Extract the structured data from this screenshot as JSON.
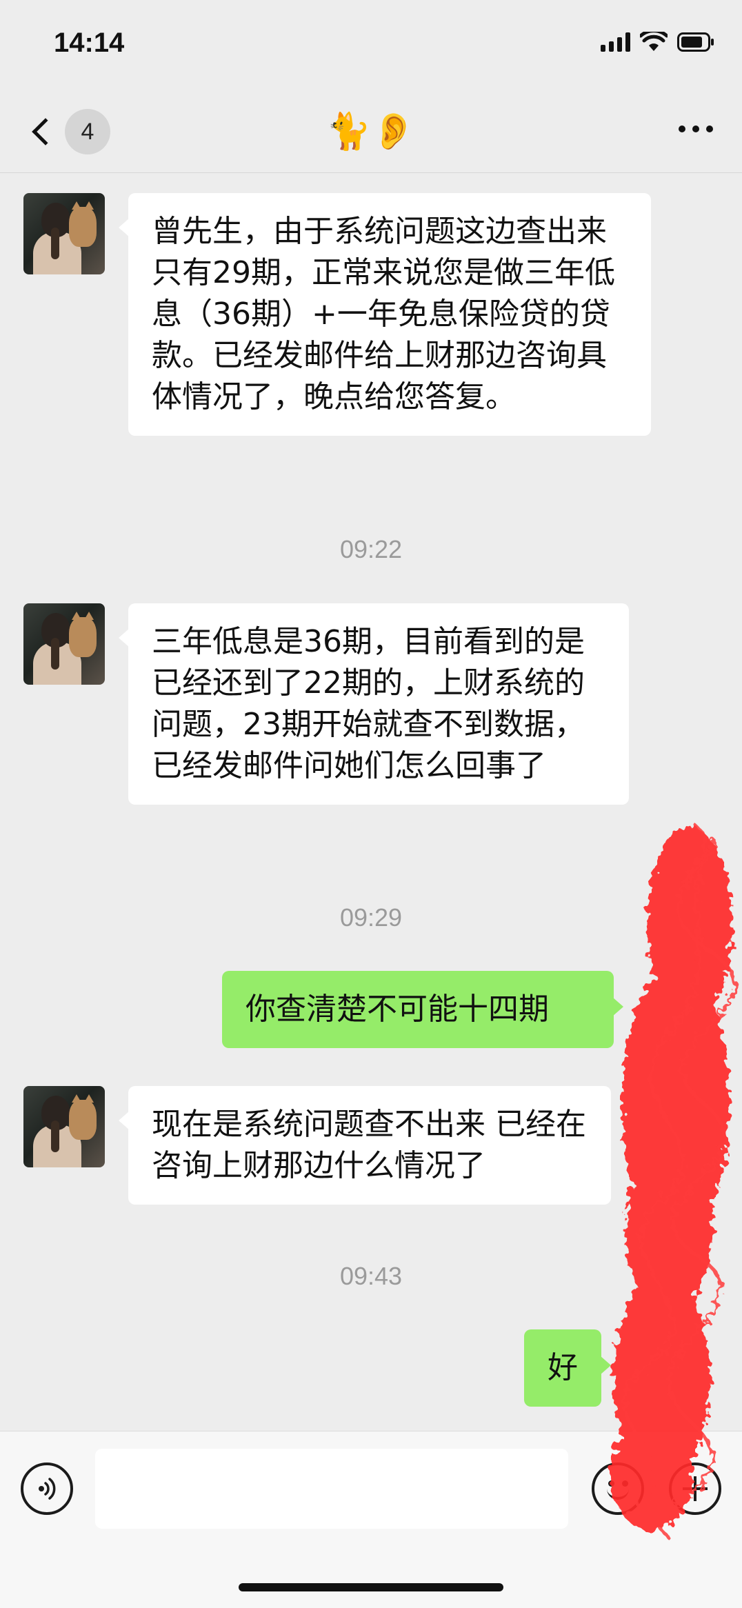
{
  "status_bar": {
    "time": "14:14"
  },
  "nav": {
    "unread_count": "4",
    "title": "🐈👂"
  },
  "messages": [
    {
      "side": "left",
      "text": " 曾先生，由于系统问题这边查出来只有29期，正常来说您是做三年低息（36期）+一年免息保险贷的贷款。已经发邮件给上财那边咨询具体情况了，晚点给您答复。"
    },
    {
      "type": "time",
      "text": "09:22"
    },
    {
      "side": "left",
      "text": "三年低息是36期，目前看到的是已经还到了22期的，上财系统的问题，23期开始就查不到数据，已经发邮件问她们怎么回事了"
    },
    {
      "type": "time",
      "text": "09:29"
    },
    {
      "side": "right",
      "text": "你查清楚不可能十四期"
    },
    {
      "side": "left",
      "text": "现在是系统问题查不出来 已经在咨询上财那边什么情况了"
    },
    {
      "type": "time",
      "text": "09:43"
    },
    {
      "side": "right",
      "text": "好"
    }
  ],
  "input": {
    "placeholder": ""
  },
  "icons": {
    "voice": "voice-icon",
    "emoji": "emoji-icon",
    "more": "plus-icon"
  },
  "colors": {
    "background": "#ededed",
    "bubble_left": "#ffffff",
    "bubble_right": "#95ec69",
    "redaction": "#ff2d2d"
  }
}
